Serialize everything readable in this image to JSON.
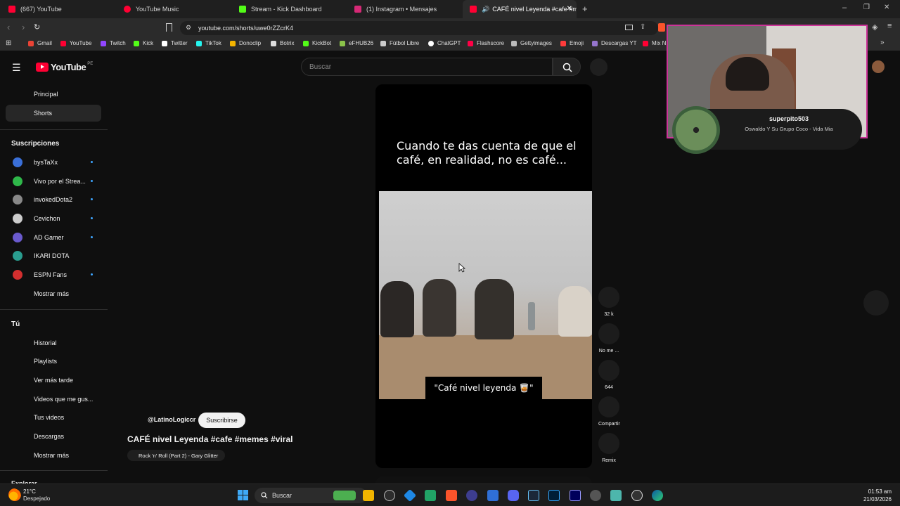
{
  "tabs": [
    {
      "label": "(667) YouTube",
      "color": "#ff0033"
    },
    {
      "label": "YouTube Music",
      "color": "#ff0033"
    },
    {
      "label": "Stream - Kick Dashboard",
      "color": "#53fc18"
    },
    {
      "label": "(1) Instagram • Mensajes",
      "color": "#d62976"
    },
    {
      "label": "CAFÉ nivel Leyenda #cafe #m",
      "color": "#ff0033"
    }
  ],
  "address": "youtube.com/shorts/uwe0rZZcrK4",
  "bookmarks": [
    "Gmail",
    "YouTube",
    "Twitch",
    "Kick",
    "Twitter",
    "TikTok",
    "Donoclip",
    "Botrix",
    "KickBot",
    "eFHUB26",
    "Fútbol Libre",
    "ChatGPT",
    "Flashscore",
    "Gettyimages",
    "Emoji",
    "Descargas YT",
    "Mix N"
  ],
  "yt": {
    "logo": "YouTube",
    "region": "PE",
    "search_placeholder": "Buscar",
    "nav": [
      "Principal",
      "Shorts"
    ],
    "subs_title": "Suscripciones",
    "subs": [
      {
        "name": "bysTaXx",
        "color": "#3a6fd8"
      },
      {
        "name": "Vivo por el Strea...",
        "color": "#2fb84a"
      },
      {
        "name": "invokedDota2",
        "color": "#888888"
      },
      {
        "name": "Cevichon",
        "color": "#cccccc"
      },
      {
        "name": "AD Gamer",
        "color": "#6a5acd"
      },
      {
        "name": "IKARI DOTA",
        "color": "#2a9d8f"
      },
      {
        "name": "ESPN Fans",
        "color": "#d32f2f"
      }
    ],
    "subs_more": "Mostrar más",
    "you_title": "Tú",
    "you": [
      "Historial",
      "Playlists",
      "Ver más tarde",
      "Videos que me gus...",
      "Tus videos",
      "Descargas",
      "Mostrar más"
    ],
    "explore_partial": "Explorar",
    "video_caption": "Cuando te das cuenta de que el café, en realidad, no es café...",
    "video_subtitle": "\"Café nivel leyenda 🥃\"",
    "channel": "@LatinoLogiccr",
    "subscribe": "Suscribirse",
    "title": "CAFÉ nivel Leyenda #cafe #memes #viral",
    "music": "Rock 'n' Roll (Part 2) - Gary Glitter",
    "actions": [
      {
        "label": "32 k"
      },
      {
        "label": "No me ..."
      },
      {
        "label": "644"
      },
      {
        "label": "Compartir"
      },
      {
        "label": "Remix"
      }
    ]
  },
  "overlay": {
    "user": "superpito503",
    "song": "Oswaldo Y Su Grupo Coco - Vida Mia"
  },
  "taskbar": {
    "weather_temp": "21°C",
    "weather_desc": "Despejado",
    "search": "Buscar",
    "time": "01:53 am",
    "date": "21/03/2026"
  }
}
